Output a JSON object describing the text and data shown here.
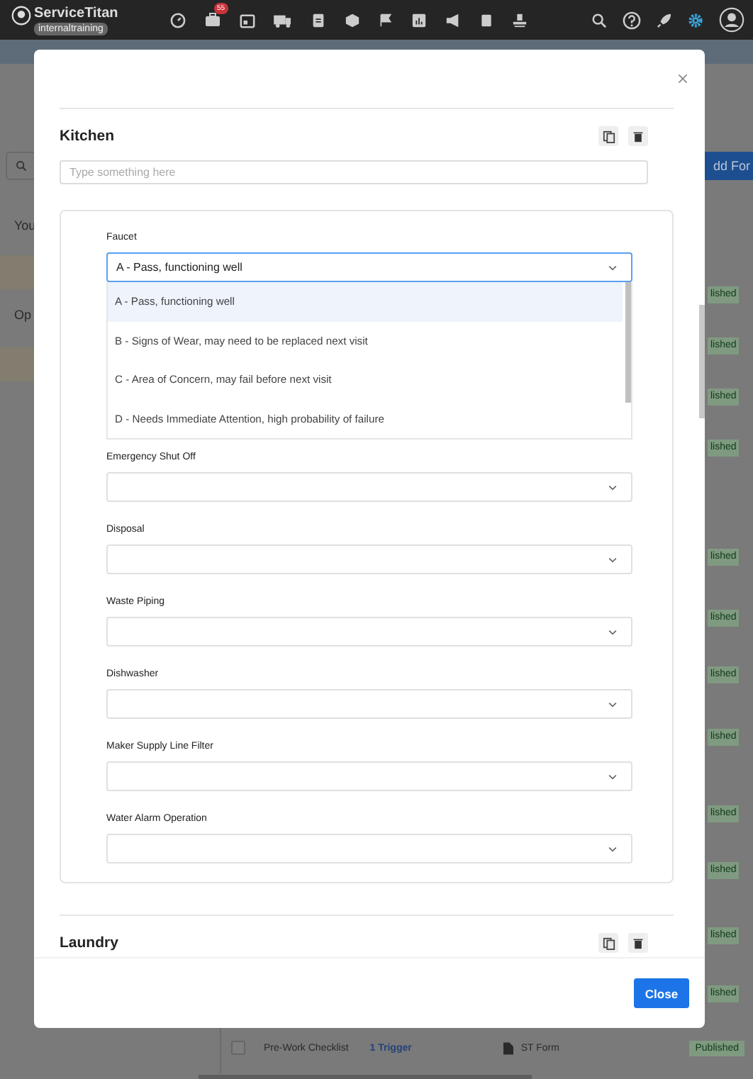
{
  "nav": {
    "logo": "ServiceTitan",
    "account": "internaltraining",
    "badge": "55"
  },
  "background": {
    "left_texts": [
      "You",
      "Op"
    ],
    "button": "dd For",
    "badges": [
      "lished",
      "lished",
      "lished",
      "lished",
      "lished",
      "lished",
      "lished",
      "lished",
      "lished",
      "lished",
      "lished",
      "lished"
    ],
    "row": {
      "name": "Pre-Work Checklist",
      "trigger": "1 Trigger",
      "type": "ST Form",
      "status": "Published",
      "checked": false
    }
  },
  "modal": {
    "sections": [
      {
        "title": "Kitchen",
        "note": {
          "placeholder": "Type something here"
        },
        "fields": [
          {
            "label": "Faucet",
            "value": "A - Pass, functioning well",
            "expanded": true,
            "options": [
              {
                "label": "A - Pass, functioning well",
                "selected": true
              },
              {
                "label": "B - Signs of Wear, may need to be replaced next visit",
                "selected": false
              },
              {
                "label": "C - Area of Concern, may fail before next visit",
                "selected": false
              },
              {
                "label": "D - Needs Immediate Attention, high probability of failure",
                "selected": false
              }
            ]
          },
          {
            "label": "Emergency Shut Off",
            "expanded": false
          },
          {
            "label": "Disposal",
            "expanded": false
          },
          {
            "label": "Waste Piping",
            "expanded": false
          },
          {
            "label": "Dishwasher",
            "expanded": false
          },
          {
            "label": "Maker Supply Line Filter",
            "expanded": false
          },
          {
            "label": "Water Alarm Operation",
            "expanded": false
          }
        ]
      },
      {
        "title": "Laundry"
      }
    ],
    "close_button": "Close"
  }
}
